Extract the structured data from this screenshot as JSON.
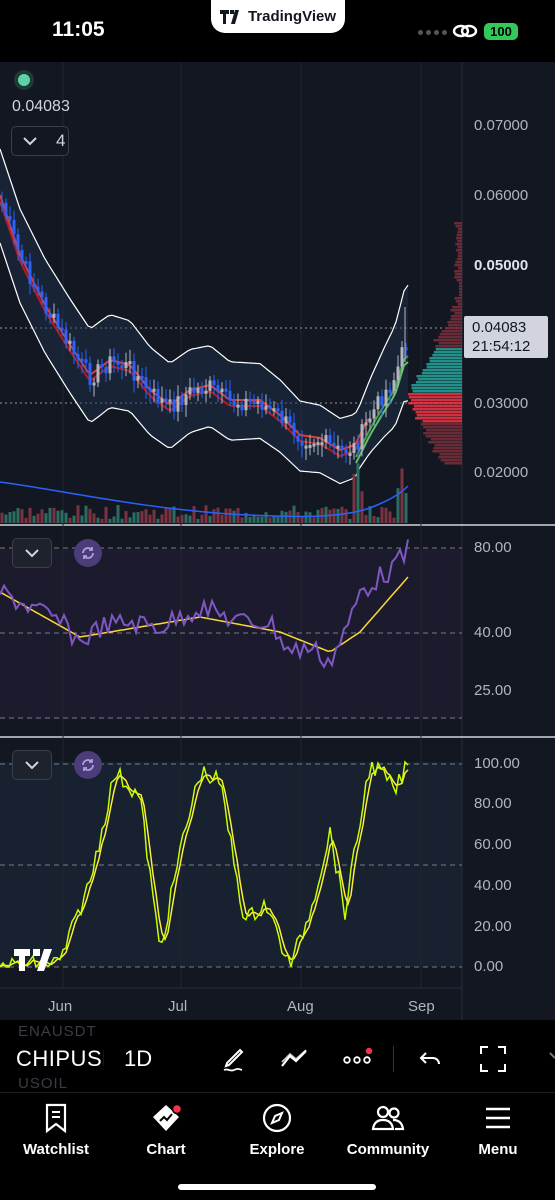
{
  "status_bar": {
    "time": "11:05",
    "app_pill": "TradingView",
    "battery": "100"
  },
  "chart": {
    "price_readout": "0.04083",
    "collapsed_count": "4",
    "last_price": "0.04083",
    "countdown": "21:54:12",
    "price_axis": [
      "0.07000",
      "0.06000",
      "0.05000",
      "0.04083",
      "0.03000",
      "0.02000"
    ],
    "rsi_axis": [
      "80.00",
      "40.00",
      "25.00"
    ],
    "stoch_axis": [
      "100.00",
      "80.00",
      "60.00",
      "40.00",
      "20.00",
      "0.00"
    ],
    "months": [
      "Jun",
      "Jul",
      "Aug",
      "Sep"
    ],
    "colors": {
      "background": "#131722",
      "bull": "#b2b5be",
      "bear": "#2962ff",
      "ema_red": "#e53935",
      "rsi": "#7e57c2",
      "rsi_ma": "#fdd835",
      "stoch_k": "#c6ff00",
      "stoch_d": "#ffeb3b"
    }
  },
  "toolbar": {
    "symbol": "CHIPUSDT",
    "symbol_above": "ENAUSDT",
    "symbol_below": "USOIL",
    "interval": "1D",
    "tools": [
      "draw-icon",
      "indicators-icon",
      "more-icon",
      "undo-icon",
      "fullscreen-icon"
    ]
  },
  "bottom_nav": {
    "items": [
      {
        "label": "Watchlist",
        "icon": "bookmark-icon"
      },
      {
        "label": "Chart",
        "icon": "chart-icon"
      },
      {
        "label": "Explore",
        "icon": "compass-icon"
      },
      {
        "label": "Community",
        "icon": "people-icon"
      },
      {
        "label": "Menu",
        "icon": "hamburger-icon"
      }
    ]
  }
}
